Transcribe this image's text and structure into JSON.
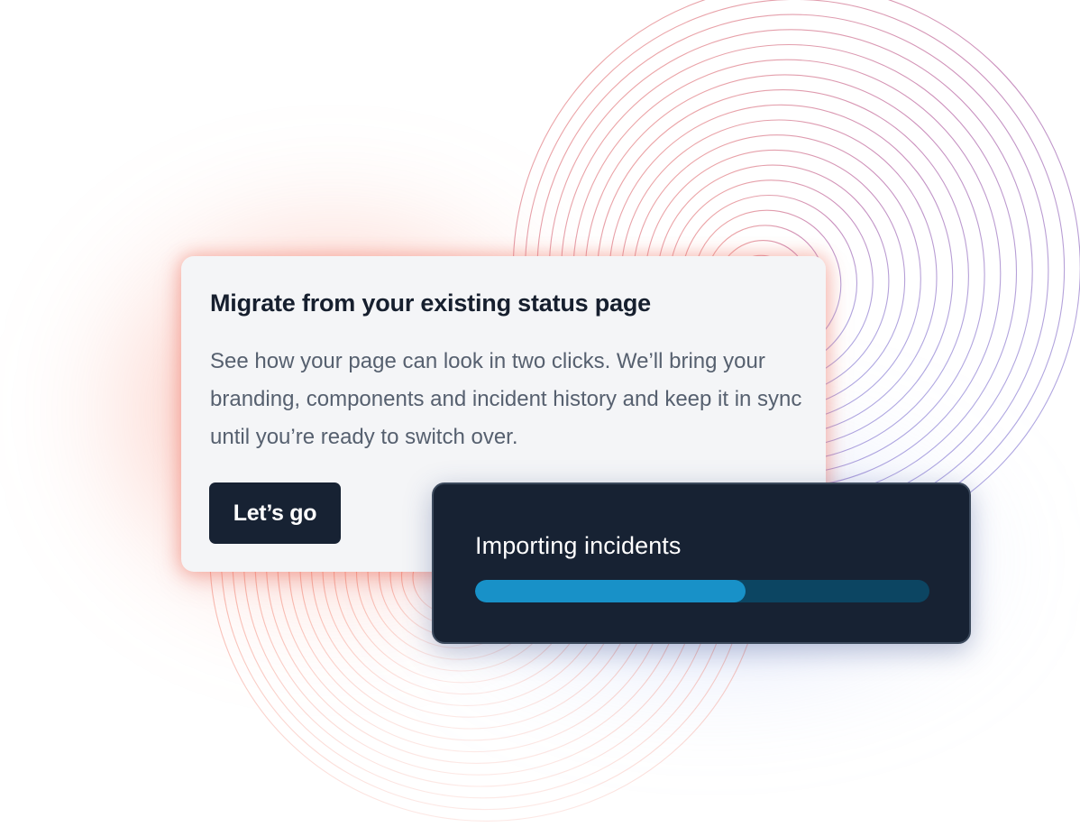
{
  "migrate_card": {
    "title": "Migrate from your existing status page",
    "body": "See how your page can look in two clicks. We’ll bring your branding, components and incident history and keep it in sync until you’re ready to switch over.",
    "button_label": "Let’s go"
  },
  "import_card": {
    "title": "Importing incidents",
    "progress_percent": 59.5
  },
  "colors": {
    "card_background": "#f4f5f7",
    "dark_background": "#172233",
    "progress_fill": "#1891c8",
    "progress_track": "#0c4562",
    "ring_red": "#ef5a45",
    "ring_blue": "#5f6fe0"
  }
}
